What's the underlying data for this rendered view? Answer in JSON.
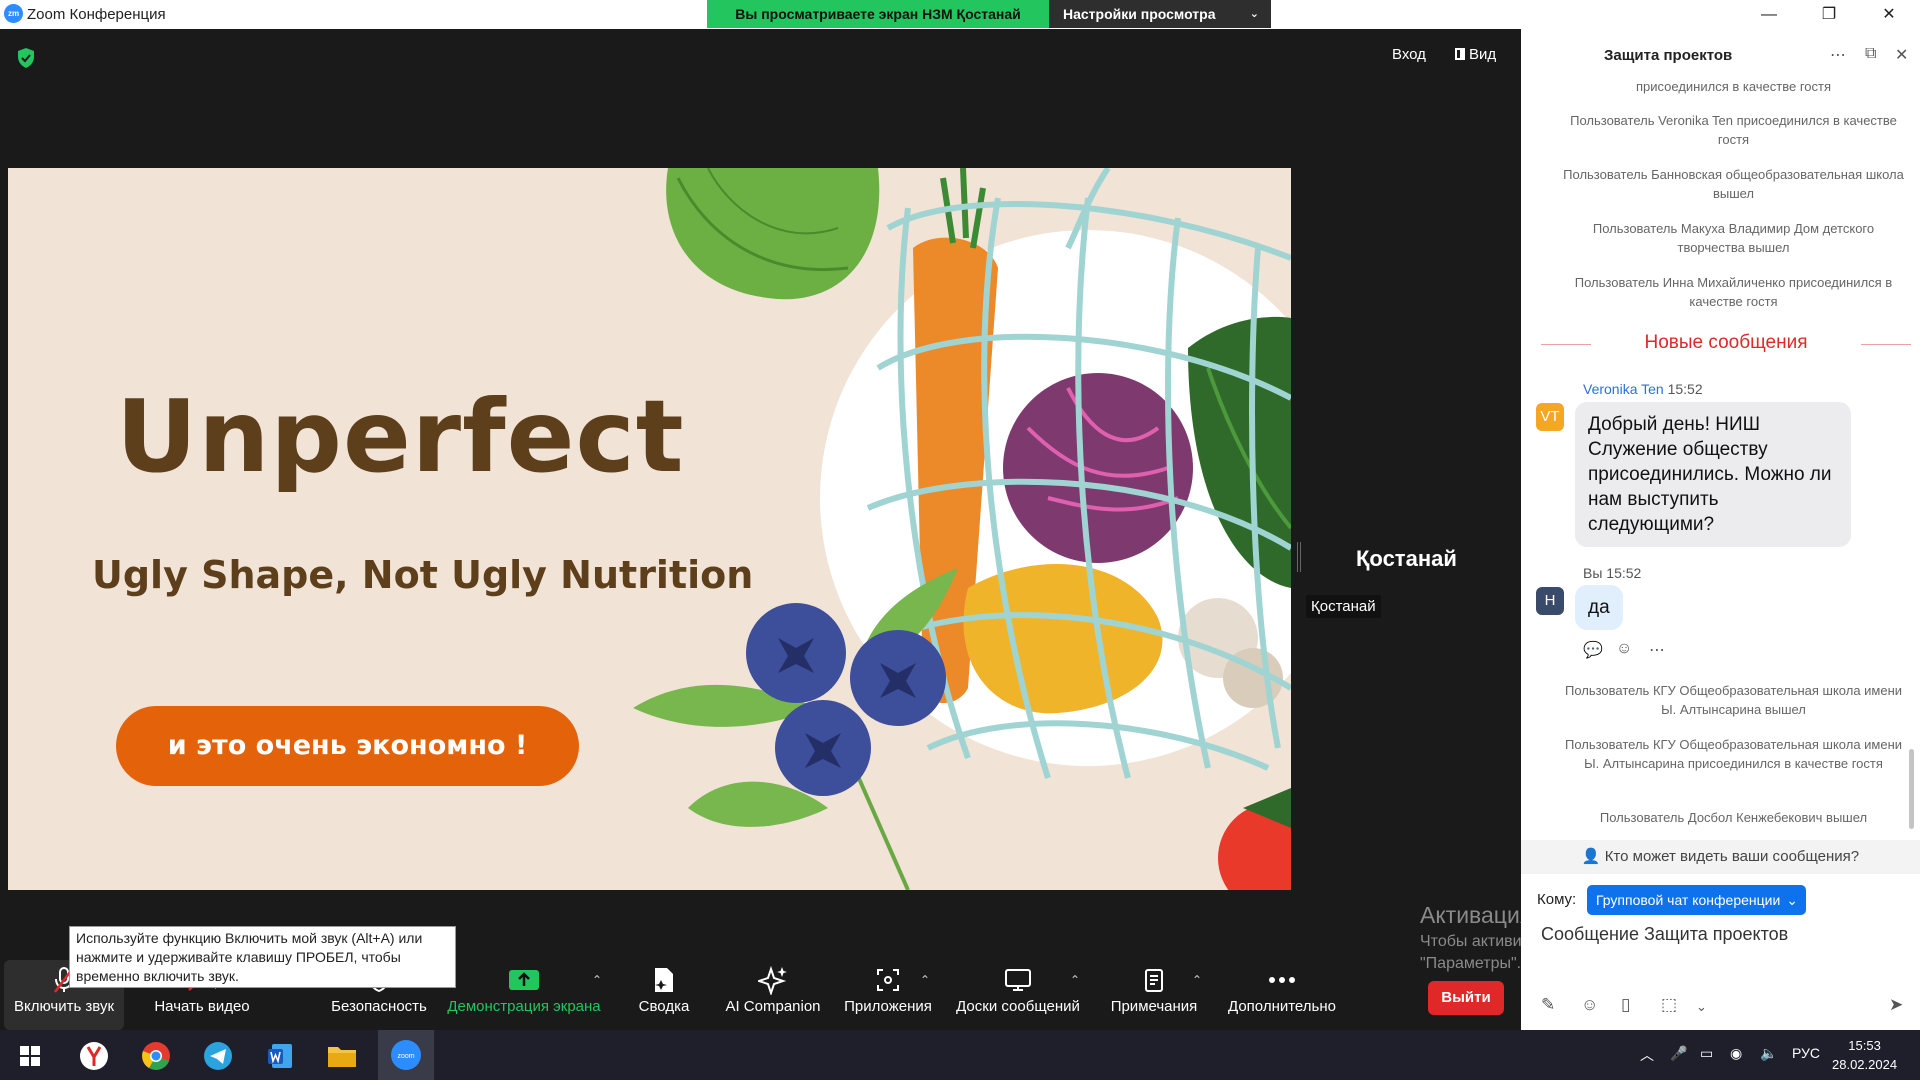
{
  "window": {
    "logo": "zm",
    "title": "Zoom Конференция",
    "min": "—",
    "restore": "❐",
    "close": "✕"
  },
  "share_bar": {
    "viewing": "Вы просматриваете экран НЗМ Қостанай",
    "options": "Настройки просмотра",
    "chevron": "⌄"
  },
  "top_controls": {
    "enter": "Вход",
    "view": "Вид"
  },
  "slide": {
    "title": "Unperfect",
    "subtitle": "Ugly Shape, Not Ugly Nutrition",
    "button": "и это очень экономно !"
  },
  "participant": {
    "name": "Қостанай",
    "label": "Қостанай"
  },
  "tooltip": "Используйте функцию Включить мой звук (Alt+A) или нажмите и удерживайте клавишу ПРОБЕЛ, чтобы временно включить звук.",
  "toolbar": {
    "unmute": "Включить звук",
    "start_video": "Начать видео",
    "security": "Безопасность",
    "share": "Демонстрация экрана",
    "summary": "Сводка",
    "ai": "AI Companion",
    "apps": "Приложения",
    "whiteboards": "Доски сообщений",
    "notes": "Примечания",
    "more": "Дополнительно",
    "leave": "Выйти",
    "caret": "⌃"
  },
  "activation": {
    "title": "Активация Windows",
    "text": "Чтобы активировать Windows, перейдите в раздел \"Параметры\"."
  },
  "chat": {
    "title": "Защита проектов",
    "system_top": [
      "присоединился в качестве гостя",
      "Пользователь Veronika Ten присоединился в качестве гостя",
      "Пользователь Банновская общеобразовательная школа вышел",
      "Пользователь Макуха Владимир Дом детского творчества вышел",
      "Пользователь Инна Михайличенко присоединился в качестве гостя"
    ],
    "new_messages": "Новые сообщения",
    "msg1": {
      "avatar": "VT",
      "sender": "Veronika Ten",
      "time": "15:52",
      "text": "Добрый день! НИШ Служение обществу присоединились. Можно ли нам выступить следующими?"
    },
    "msg2": {
      "avatar": "Н",
      "sender": "Вы",
      "time": "15:52",
      "text": "да"
    },
    "system_bottom": [
      "Пользователь КГУ Общеобразовательная школа имени Ы. Алтынсарина вышел",
      "Пользователь КГУ Общеобразовательная школа имени Ы. Алтынсарина присоединился в качестве гостя",
      "Пользователь Досбол Кенжебекович вышел"
    ],
    "who_can_see": "Кто может видеть ваши сообщения?",
    "to_label": "Кому:",
    "to_value": "Групповой чат конференции",
    "placeholder": "Сообщение Защита проектов",
    "header_icons": [
      "more-icon",
      "popout-icon",
      "close-icon"
    ]
  },
  "taskbar": {
    "lang": "РУС",
    "time": "15:53",
    "date": "28.02.2024"
  },
  "colors": {
    "zoom_blue": "#0e72ed",
    "share_green": "#23c55e",
    "leave_red": "#e02828",
    "slide_bg": "#f1e3d6",
    "slide_text": "#5e3f1c",
    "pill_orange": "#e4630a"
  }
}
